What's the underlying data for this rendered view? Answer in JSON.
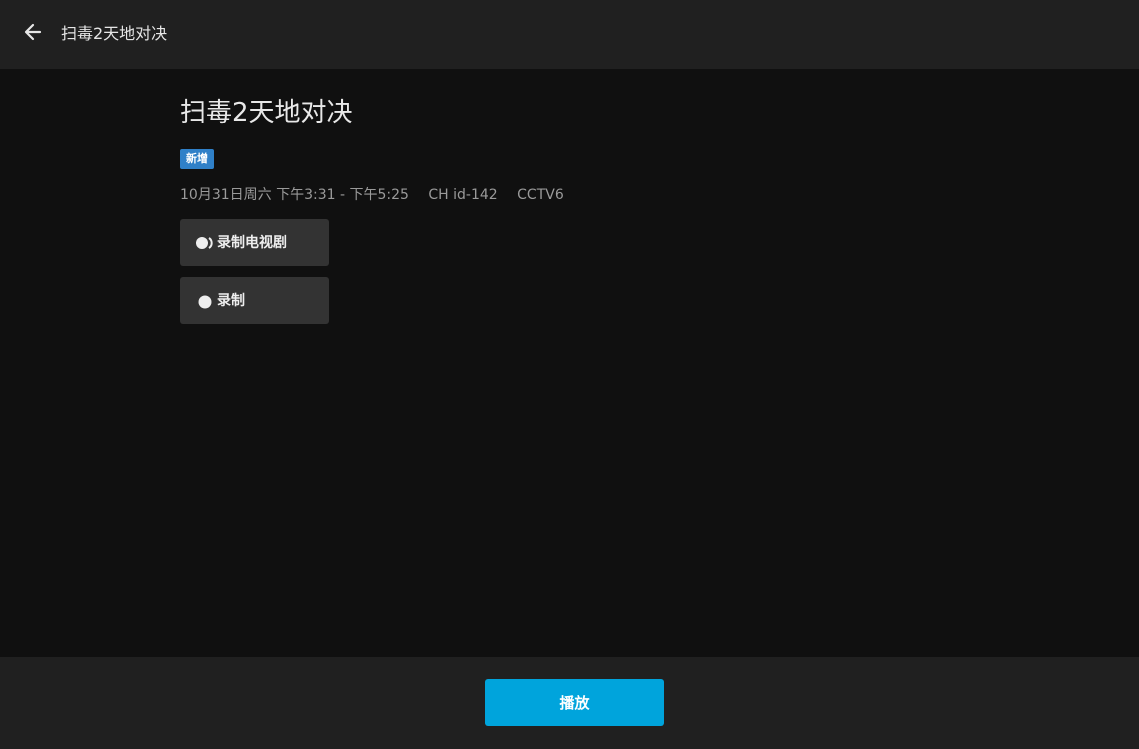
{
  "header": {
    "title": "扫毒2天地对决",
    "back_icon": "arrow-left-icon"
  },
  "program": {
    "title": "扫毒2天地对决",
    "badge": "新增",
    "badge_color": "#2f80c8",
    "time": "10月31日周六 下午3:31 - 下午5:25",
    "channel_id": "CH id-142",
    "channel_name": "CCTV6"
  },
  "actions": {
    "record_series": {
      "label": "录制电视剧",
      "icon": "record-series-icon"
    },
    "record": {
      "label": "录制",
      "icon": "record-dot-icon"
    }
  },
  "footer": {
    "play_label": "播放",
    "accent": "#00a4dc"
  },
  "colors": {
    "background": "#101010",
    "bar": "#202020",
    "button": "#333333"
  }
}
